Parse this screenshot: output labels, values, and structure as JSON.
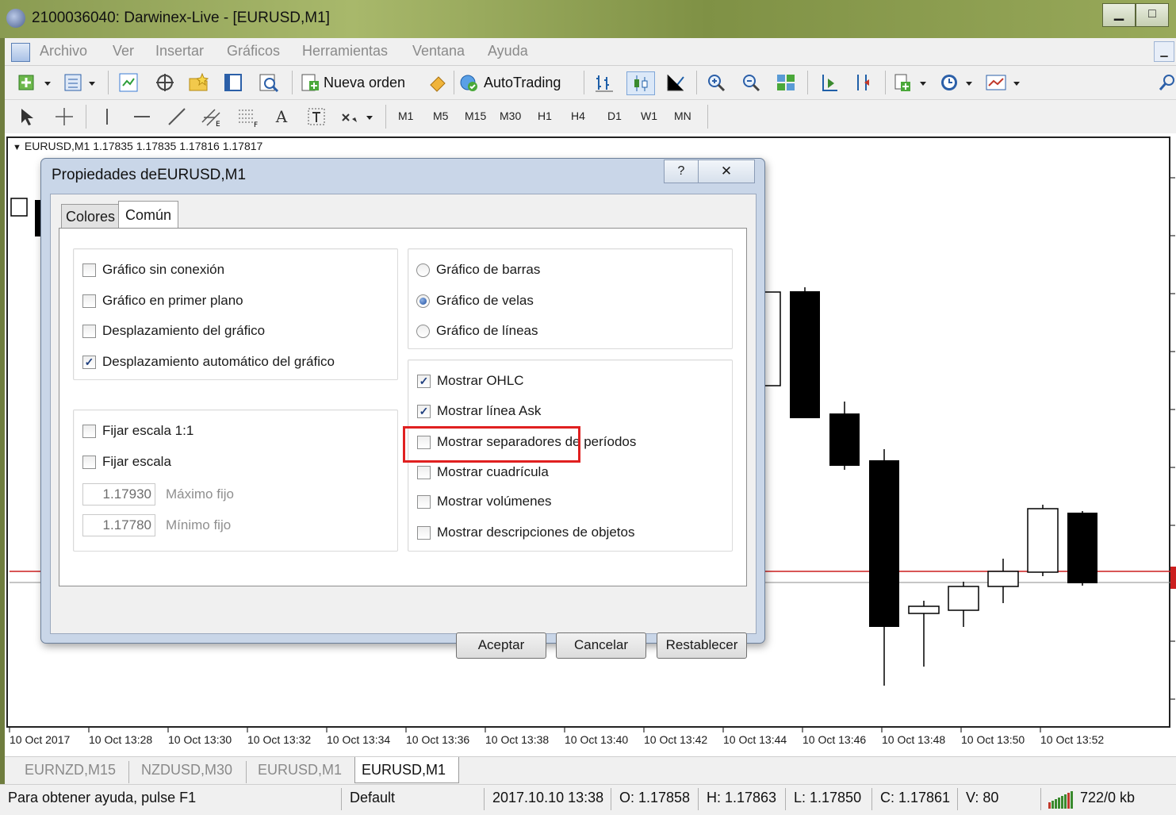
{
  "window": {
    "title": "2100036040: Darwinex-Live - [EURUSD,M1]",
    "minimize": "▁",
    "maximize": "□"
  },
  "menu": [
    "Archivo",
    "Ver",
    "Insertar",
    "Gráficos",
    "Herramientas",
    "Ventana",
    "Ayuda"
  ],
  "toolbar": {
    "new_order": "Nueva orden",
    "autotrading": "AutoTrading"
  },
  "timeframes": [
    "M1",
    "M5",
    "M15",
    "M30",
    "H1",
    "H4",
    "D1",
    "W1",
    "MN"
  ],
  "chart": {
    "info": "EURUSD,M1  1.17835 1.17835 1.17816 1.17817",
    "time_labels": [
      "10 Oct 2017",
      "10 Oct 13:28",
      "10 Oct 13:30",
      "10 Oct 13:32",
      "10 Oct 13:34",
      "10 Oct 13:36",
      "10 Oct 13:38",
      "10 Oct 13:40",
      "10 Oct 13:42",
      "10 Oct 13:44",
      "10 Oct 13:46",
      "10 Oct 13:48",
      "10 Oct 13:50",
      "10 Oct 13:52"
    ],
    "ask_line_color": "#cc1f1f"
  },
  "chart_tabs": [
    "EURNZD,M15",
    "NZDUSD,M30",
    "EURUSD,M1",
    "EURUSD,M1"
  ],
  "status": {
    "help": "Para obtener ayuda, pulse F1",
    "profile": "Default",
    "datetime": "2017.10.10 13:38",
    "open": "O: 1.17858",
    "high": "H: 1.17863",
    "low": "L: 1.17850",
    "close": "C: 1.17861",
    "volume": "V: 80",
    "traffic": "722/0 kb"
  },
  "dialog": {
    "title": "Propiedades deEURUSD,M1",
    "help_glyph": "?",
    "close_glyph": "✕",
    "tabs": [
      "Colores",
      "Común"
    ],
    "left_group1": [
      {
        "label": "Gráfico sin conexión",
        "checked": false
      },
      {
        "label": "Gráfico en primer plano",
        "checked": false
      },
      {
        "label": "Desplazamiento del gráfico",
        "checked": false
      },
      {
        "label": "Desplazamiento automático del gráfico",
        "checked": true
      }
    ],
    "left_group2": [
      {
        "label": "Fijar escala 1:1",
        "checked": false
      },
      {
        "label": "Fijar escala",
        "checked": false
      }
    ],
    "fixed_max": {
      "value": "1.17930",
      "label": "Máximo fijo"
    },
    "fixed_min": {
      "value": "1.17780",
      "label": "Mínimo fijo"
    },
    "chart_types": [
      {
        "label": "Gráfico de barras",
        "selected": false
      },
      {
        "label": "Gráfico de velas",
        "selected": true
      },
      {
        "label": "Gráfico de líneas",
        "selected": false
      }
    ],
    "show_options": [
      {
        "label": "Mostrar OHLC",
        "checked": true
      },
      {
        "label": "Mostrar línea Ask",
        "checked": true
      },
      {
        "label": "Mostrar separadores de períodos",
        "checked": false
      },
      {
        "label": "Mostrar cuadrícula",
        "checked": false
      },
      {
        "label": "Mostrar volúmenes",
        "checked": false
      },
      {
        "label": "Mostrar descripciones de objetos",
        "checked": false
      }
    ],
    "buttons": {
      "ok": "Aceptar",
      "cancel": "Cancelar",
      "reset": "Restablecer"
    },
    "highlight_color": "#e02020"
  }
}
